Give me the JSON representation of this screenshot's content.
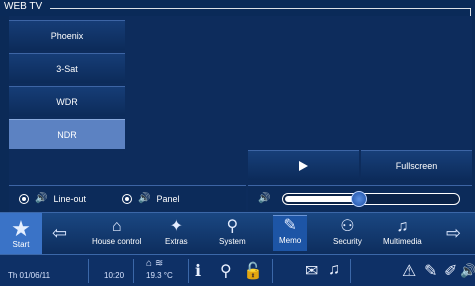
{
  "window": {
    "title": "WEB TV"
  },
  "channels": [
    {
      "label": "Phoenix",
      "selected": false
    },
    {
      "label": "3-Sat",
      "selected": false
    },
    {
      "label": "WDR",
      "selected": false
    },
    {
      "label": "NDR",
      "selected": true
    }
  ],
  "player": {
    "play_icon": "play-icon",
    "fullscreen_label": "Fullscreen"
  },
  "audio": {
    "lineout_label": "Line-out",
    "panel_label": "Panel",
    "volume_percent": 43
  },
  "nav": {
    "start_label": "Start",
    "items": [
      {
        "label": "House control",
        "icon": "house-icon"
      },
      {
        "label": "Extras",
        "icon": "extras-icon"
      },
      {
        "label": "System",
        "icon": "system-icon"
      },
      {
        "label": "Memo",
        "icon": "memo-icon"
      },
      {
        "label": "Security",
        "icon": "security-icon"
      },
      {
        "label": "Multimedia",
        "icon": "multimedia-icon"
      }
    ]
  },
  "status": {
    "date": "Th 01/06/11",
    "time": "10:20",
    "temperature": "19.3 °C"
  },
  "colors": {
    "accent": "#3a73c7",
    "background": "#0b2a57",
    "selected_channel": "#5c82c2"
  }
}
